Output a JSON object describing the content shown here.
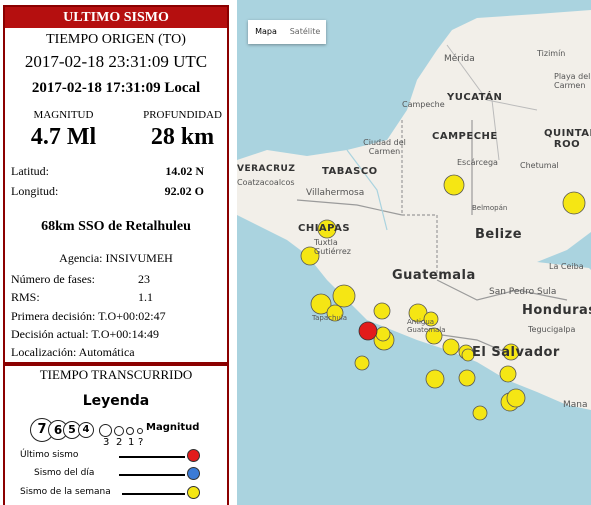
{
  "panel": {
    "title": "ULTIMO SISMO",
    "origin_heading": "TIEMPO ORIGEN (TO)",
    "utc_time": "2017-02-18 23:31:09 UTC",
    "local_time": "2017-02-18 17:31:09 Local",
    "magnitude_label": "MAGNITUD",
    "depth_label": "PROFUNDIDAD",
    "magnitude_value": "4.7 Ml",
    "depth_value": "28 km",
    "lat_label": "Latitud:",
    "lat_value": "14.02 N",
    "lon_label": "Longitud:",
    "lon_value": "92.02 O",
    "region": "68km SSO de Retalhuleu",
    "agency": "Agencia: INSIVUMEH",
    "phases_label": "Número de fases:",
    "phases_value": "23",
    "rms_label": "RMS:",
    "rms_value": "1.1",
    "first_decision": "Primera decisión: T.O+00:02:47",
    "current_decision": "Decisión actual: T.O+00:14:49",
    "location_type": "Localización: Automática",
    "elapsed_heading": "TIEMPO TRANSCURRIDO"
  },
  "legend": {
    "title": "Leyenda",
    "circles": [
      "7",
      "6",
      "5",
      "4"
    ],
    "small_labels": [
      "3",
      "2",
      "1",
      "?"
    ],
    "magnitude_word": "Magnitud",
    "items": [
      {
        "label": "Último sismo",
        "color": "#e21b1b"
      },
      {
        "label": "Sismo del día",
        "color": "#3b7bd6"
      },
      {
        "label": "Sismo de la semana",
        "color": "#f5e614"
      }
    ]
  },
  "map": {
    "buttons": {
      "map": "Mapa",
      "satellite": "Satélite"
    },
    "labels": {
      "merida": "Mérida",
      "tizimin": "Tizimín",
      "cancun_area": "Playa del Carmen",
      "yucatan": "YUCATÁN",
      "campeche_city": "Campeche",
      "campeche": "CAMPECHE",
      "quintana_roo": "QUINTANA ROO",
      "ciudad_carmen": "Ciudad del Carmen",
      "escarcega": "Escárcega",
      "chetumal": "Chetumal",
      "tabasco": "TABASCO",
      "villahermosa": "Villahermosa",
      "veracruz": "VERACRUZ",
      "coatzacoalcos": "Coatzacoalcos",
      "belmopan": "Belmopán",
      "belize": "Belize",
      "chiapas": "CHIAPAS",
      "tuxtla": "Tuxtla Gutiérrez",
      "guatemala": "Guatemala",
      "la_ceiba": "La Ceiba",
      "san_pedro_sula": "San Pedro Sula",
      "honduras": "Honduras",
      "tegucigalpa": "Tegucigalpa",
      "el_salvador": "El Salvador",
      "antigua": "Antigua Guatemala",
      "tonala_area": "Tapachula",
      "managua": "Mana"
    },
    "colors": {
      "water": "#aad3df",
      "land": "#f2efe9",
      "border": "#9b9b9b",
      "latest_quake": "#e21b1b",
      "weekly_quake": "#f5e614"
    },
    "quakes_weekly_count": 24,
    "latest_quake": {
      "lat": 14.02,
      "lon": -92.02
    }
  }
}
